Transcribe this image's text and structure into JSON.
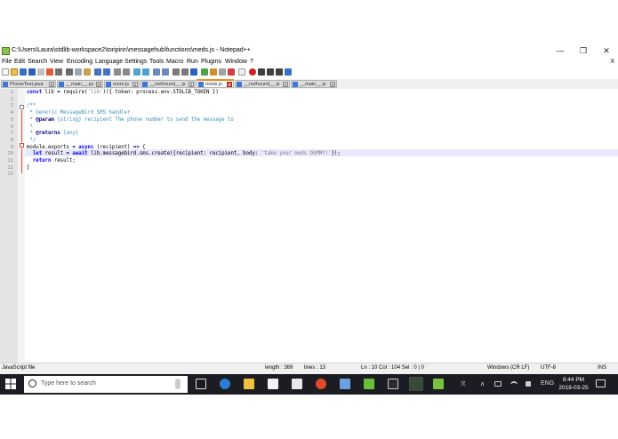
{
  "window": {
    "title": "C:\\Users\\Laura\\stdlib-workspace2\\toripinn\\messagehub\\functions\\meds.js - Notepad++",
    "minimize_glyph": "—",
    "maximize_glyph": "❐",
    "close_glyph": "✕",
    "doc_close_glyph": "X"
  },
  "menu": [
    "File",
    "Edit",
    "Search",
    "View",
    "Encoding",
    "Language",
    "Settings",
    "Tools",
    "Macro",
    "Run",
    "Plugins",
    "Window",
    "?"
  ],
  "tabs": [
    {
      "label": "PhoneTest.java",
      "active": false
    },
    {
      "label": "__main__.py",
      "active": false
    },
    {
      "label": "more.js",
      "active": false
    },
    {
      "label": "__nothound__.js",
      "active": false
    },
    {
      "label": "meds.js",
      "active": true
    },
    {
      "label": "__nothound__.js",
      "active": false
    },
    {
      "label": "__main__.js",
      "active": false
    }
  ],
  "tab_close_glyph": "x",
  "editor": {
    "line_numbers": [
      "1",
      "2",
      "3",
      "4",
      "5",
      "6",
      "7",
      "8",
      "9",
      "10",
      "11",
      "12",
      "13"
    ],
    "lines": [
      [
        {
          "c": "kw",
          "t": "const"
        },
        {
          "c": "",
          "t": " lib "
        },
        {
          "c": "op",
          "t": "="
        },
        {
          "c": "",
          "t": " require("
        },
        {
          "c": "str",
          "t": "'lib'"
        },
        {
          "c": "",
          "t": ")({ token: process.env.STDLIB_TOKEN })"
        }
      ],
      [],
      [
        {
          "c": "cm",
          "t": "/**"
        }
      ],
      [
        {
          "c": "cm",
          "t": " * Generic MessageBird SMS handler"
        }
      ],
      [
        {
          "c": "cm",
          "t": " * "
        },
        {
          "c": "op",
          "t": "@param"
        },
        {
          "c": "cm",
          "t": " {string} recipient The phone number to send the message to"
        }
      ],
      [
        {
          "c": "cm",
          "t": " *"
        }
      ],
      [
        {
          "c": "cm",
          "t": " * "
        },
        {
          "c": "op",
          "t": "@returns"
        },
        {
          "c": "cm",
          "t": " {any}"
        }
      ],
      [
        {
          "c": "cm",
          "t": " */"
        }
      ],
      [
        {
          "c": "",
          "t": "module.exports "
        },
        {
          "c": "op",
          "t": "="
        },
        {
          "c": "",
          "t": " "
        },
        {
          "c": "kw",
          "t": "async"
        },
        {
          "c": "",
          "t": " (recipient) "
        },
        {
          "c": "op",
          "t": "=>"
        },
        {
          "c": "",
          "t": " {"
        }
      ],
      [
        {
          "c": "",
          "t": "  "
        },
        {
          "c": "kw",
          "t": "let"
        },
        {
          "c": "",
          "t": " result "
        },
        {
          "c": "op",
          "t": "="
        },
        {
          "c": "",
          "t": " "
        },
        {
          "c": "kw",
          "t": "await"
        },
        {
          "c": "",
          "t": " lib.messagebird.sms.create({recipient: recipient, body: "
        },
        {
          "c": "str",
          "t": "'take your meds DUMMY!'"
        },
        {
          "c": "",
          "t": "});"
        }
      ],
      [
        {
          "c": "",
          "t": "  "
        },
        {
          "c": "kw",
          "t": "return"
        },
        {
          "c": "",
          "t": " result;"
        }
      ],
      [
        {
          "c": "",
          "t": "}"
        }
      ],
      []
    ]
  },
  "status": {
    "file_type": "JavaScript file",
    "length": "length : 369",
    "lines": "lines : 13",
    "position": "Ln : 10   Col : 104   Sel : 0 | 0",
    "eol": "Windows (CR LF)",
    "encoding": "UTF-8",
    "mode": "INS"
  },
  "taskbar": {
    "search_placeholder": "Type here to search",
    "language": "ENG",
    "time": "8:44 PM",
    "date": "2018-03-25",
    "tray_chevron": "∧",
    "tray_r": "ℛ"
  },
  "colors": {
    "accent_tab": "#f08a24",
    "keyword": "#0000ff",
    "comment": "#3f8fbf",
    "string": "#808080",
    "taskbar": "#1b1d22"
  }
}
